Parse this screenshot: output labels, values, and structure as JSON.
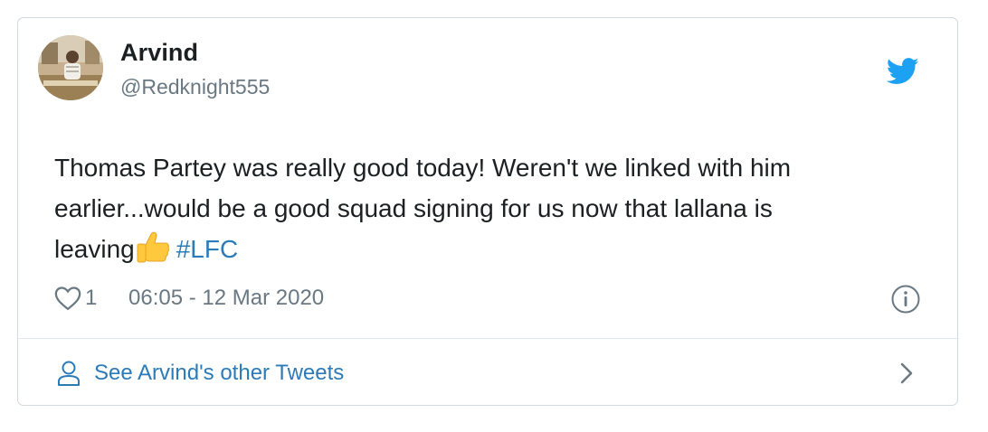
{
  "tweet": {
    "author": {
      "name": "Arvind",
      "handle": "@Redknight555",
      "avatar_icon": "avatar-photo"
    },
    "brand_icon": "twitter-bird-icon",
    "brand_color": "#1da1f2",
    "text_before_emoji_line1": "Thomas Partey was really good today! Weren't we linked with him",
    "text_before_emoji_line2": "earlier...would be a good squad signing for us now that lallana is",
    "text_before_emoji_line3": "leaving",
    "emoji": "thumbs-up-emoji",
    "hashtag": "#LFC",
    "hashtag_color": "#2b7bb9",
    "likes": "1",
    "timestamp": "06:05 - 12 Mar 2020"
  },
  "footer": {
    "label": "See Arvind's other Tweets",
    "icon": "person-icon",
    "chevron": "chevron-right-icon"
  }
}
